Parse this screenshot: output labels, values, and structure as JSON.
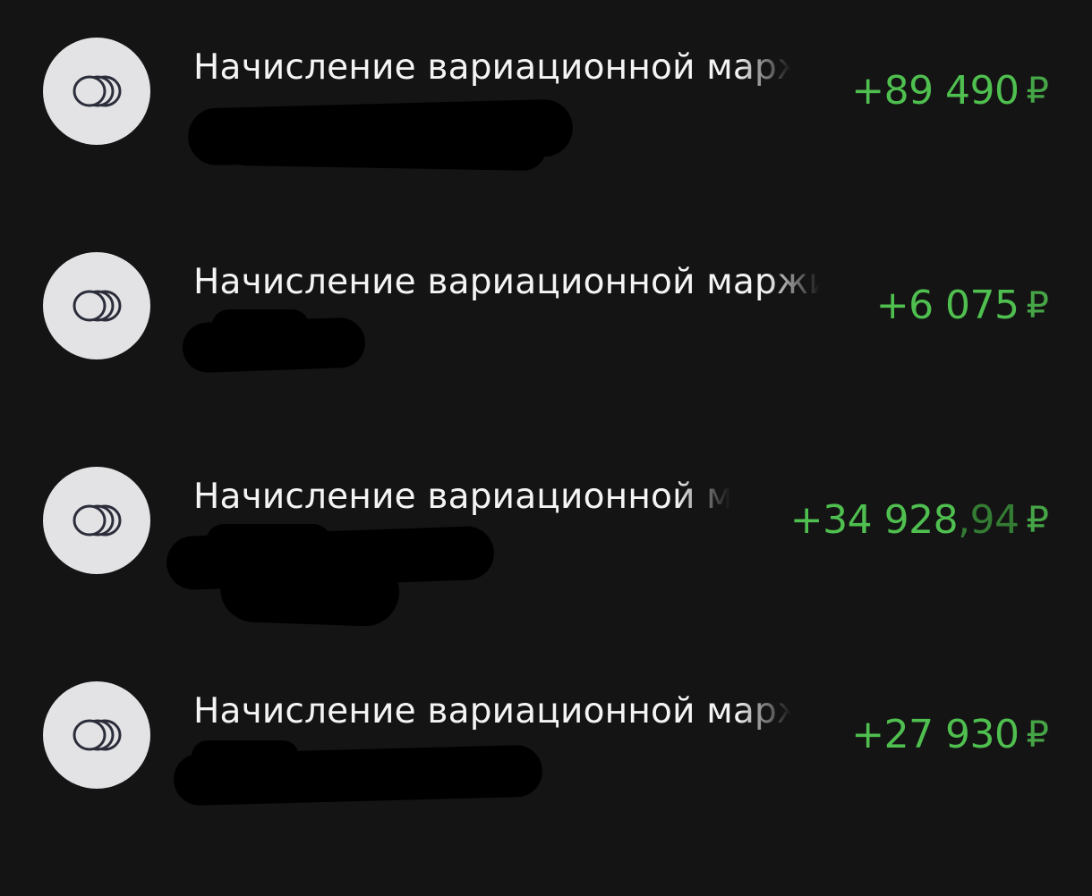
{
  "operations": [
    {
      "title": "Начисление вариационной маржи",
      "amount": "+89 490",
      "amount_cents": "",
      "currency": "₽",
      "icon": "coins-icon"
    },
    {
      "title": "Начисление вариационной маржи",
      "amount": "+6 075",
      "amount_cents": "",
      "currency": "₽",
      "icon": "coins-icon"
    },
    {
      "title": "Начисление вариационной маржи",
      "amount": "+34 928",
      "amount_cents": ",94",
      "currency": "₽",
      "icon": "coins-icon"
    },
    {
      "title": "Начисление вариационной маржи",
      "amount": "+27 930",
      "amount_cents": "",
      "currency": "₽",
      "icon": "coins-icon"
    }
  ],
  "colors": {
    "background": "#141414",
    "income": "#4fbf4f",
    "avatar_bg": "#e3e3e6",
    "title": "#f4f4f4"
  }
}
